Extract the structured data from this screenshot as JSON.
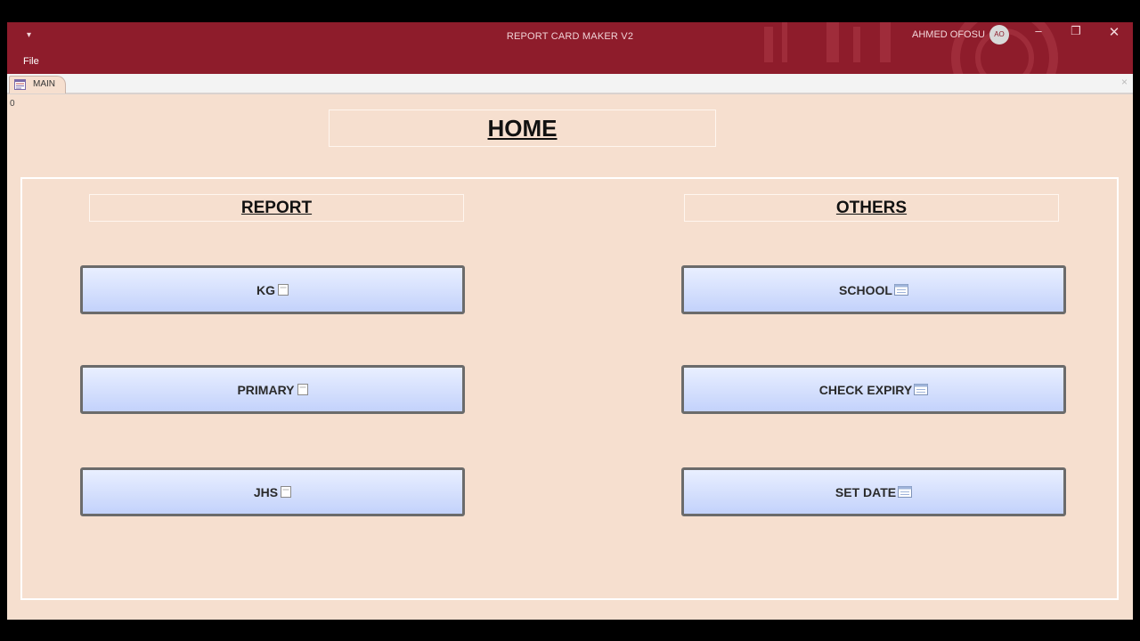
{
  "titlebar": {
    "qat_icon": "customize-quick-access-icon",
    "menu_file": "File",
    "title": "REPORT CARD MAKER V2",
    "user_name": "AHMED OFOSU",
    "avatar_initials": "AO",
    "controls": {
      "minimize": "–",
      "restore": "❐",
      "close": "✕"
    },
    "color": "#8e1c2b"
  },
  "tab": {
    "label": "MAIN",
    "icon": "form-icon",
    "close": "×"
  },
  "counter": "0",
  "home": {
    "title": "HOME"
  },
  "sections": {
    "report": {
      "title": "REPORT",
      "buttons": [
        {
          "label": "KG",
          "icon": "report-icon"
        },
        {
          "label": "PRIMARY",
          "icon": "report-icon"
        },
        {
          "label": "JHS",
          "icon": "report-icon"
        }
      ]
    },
    "others": {
      "title": "OTHERS",
      "buttons": [
        {
          "label": "SCHOOL",
          "icon": "form-icon"
        },
        {
          "label": "CHECK EXPIRY",
          "icon": "form-icon"
        },
        {
          "label": "SET DATE",
          "icon": "form-icon"
        }
      ]
    }
  },
  "colors": {
    "background": "#f6dfcf",
    "button_top": "#e9efff",
    "button_bottom": "#c3d2fb"
  }
}
